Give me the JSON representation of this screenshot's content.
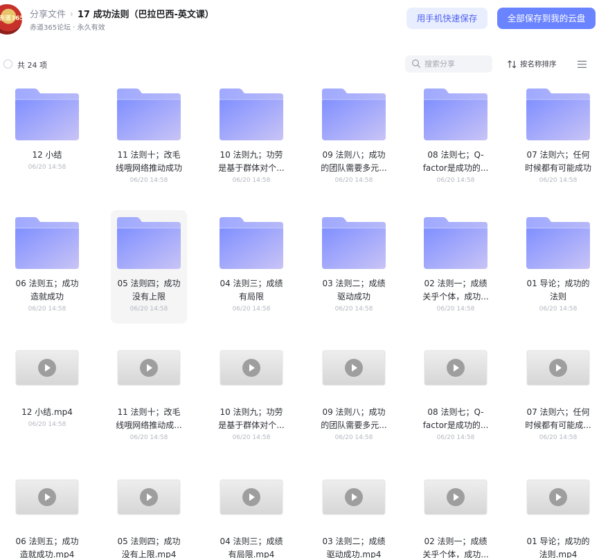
{
  "header": {
    "breadcrumb_root": "分享文件",
    "breadcrumb_current": "17 成功法则（巴拉巴西-英文课）",
    "subtitle": "赤道365论坛 · 永久有效",
    "avatar_text": "赤道365",
    "btn_phone": "用手机快速保存",
    "btn_save": "全部保存到我的云盘"
  },
  "toolbar": {
    "count": "共 24 项",
    "search_placeholder": "搜索分享",
    "sort_label": "按名称排序"
  },
  "colors": {
    "accent": "#6a83ff",
    "accent_light": "#e9eeff",
    "folder": "#8a98ff"
  },
  "items": [
    {
      "type": "folder",
      "name": [
        "12 小结"
      ],
      "date": "06/20 14:58"
    },
    {
      "type": "folder",
      "name": [
        "11 法则十；改毛",
        "线哦网络推动成功"
      ],
      "date": "06/20 14:58"
    },
    {
      "type": "folder",
      "name": [
        "10 法则九；功劳",
        "是基于群体对个..."
      ],
      "date": "06/20 14:58"
    },
    {
      "type": "folder",
      "name": [
        "09 法则八；成功",
        "的团队需要多元..."
      ],
      "date": "06/20 14:58"
    },
    {
      "type": "folder",
      "name": [
        "08 法则七；Q-",
        "factor是成功的..."
      ],
      "date": "06/20 14:58"
    },
    {
      "type": "folder",
      "name": [
        "07 法则六；任何",
        "时候都有可能成功"
      ],
      "date": "06/20 14:58"
    },
    {
      "type": "folder",
      "name": [
        "06 法则五；成功",
        "造就成功"
      ],
      "date": "06/20 14:58"
    },
    {
      "type": "folder",
      "name": [
        "05 法则四；成功",
        "没有上限"
      ],
      "date": "06/20 14:58",
      "hover": true
    },
    {
      "type": "folder",
      "name": [
        "04 法则三；成绩",
        "有局限"
      ],
      "date": "06/20 14:58"
    },
    {
      "type": "folder",
      "name": [
        "03 法则二；成绩",
        "驱动成功"
      ],
      "date": "06/20 14:58"
    },
    {
      "type": "folder",
      "name": [
        "02 法则一；成绩",
        "关乎个体，成功..."
      ],
      "date": "06/20 14:58"
    },
    {
      "type": "folder",
      "name": [
        "01 导论；成功的",
        "法则"
      ],
      "date": "06/20 14:58"
    },
    {
      "type": "video",
      "name": [
        "12 小结.mp4"
      ],
      "date": "06/20 14:58"
    },
    {
      "type": "video",
      "name": [
        "11 法则十；改毛",
        "线哦网络推动成..."
      ],
      "date": "06/20 14:58"
    },
    {
      "type": "video",
      "name": [
        "10 法则九；功劳",
        "是基于群体对个..."
      ],
      "date": "06/20 14:58"
    },
    {
      "type": "video",
      "name": [
        "09 法则八；成功",
        "的团队需要多元..."
      ],
      "date": "06/20 14:58"
    },
    {
      "type": "video",
      "name": [
        "08 法则七；Q-",
        "factor是成功的..."
      ],
      "date": "06/20 14:58"
    },
    {
      "type": "video",
      "name": [
        "07 法则六；任何",
        "时候都有可能成..."
      ],
      "date": "06/20 14:58"
    },
    {
      "type": "video",
      "name": [
        "06 法则五；成功",
        "造就成功.mp4"
      ],
      "date": ""
    },
    {
      "type": "video",
      "name": [
        "05 法则四；成功",
        "没有上限.mp4"
      ],
      "date": ""
    },
    {
      "type": "video",
      "name": [
        "04 法则三；成绩",
        "有局限.mp4"
      ],
      "date": ""
    },
    {
      "type": "video",
      "name": [
        "03 法则二；成绩",
        "驱动成功.mp4"
      ],
      "date": ""
    },
    {
      "type": "video",
      "name": [
        "02 法则一；成绩",
        "关乎个体，成功..."
      ],
      "date": ""
    },
    {
      "type": "video",
      "name": [
        "01 导论；成功的",
        "法则.mp4"
      ],
      "date": ""
    }
  ]
}
